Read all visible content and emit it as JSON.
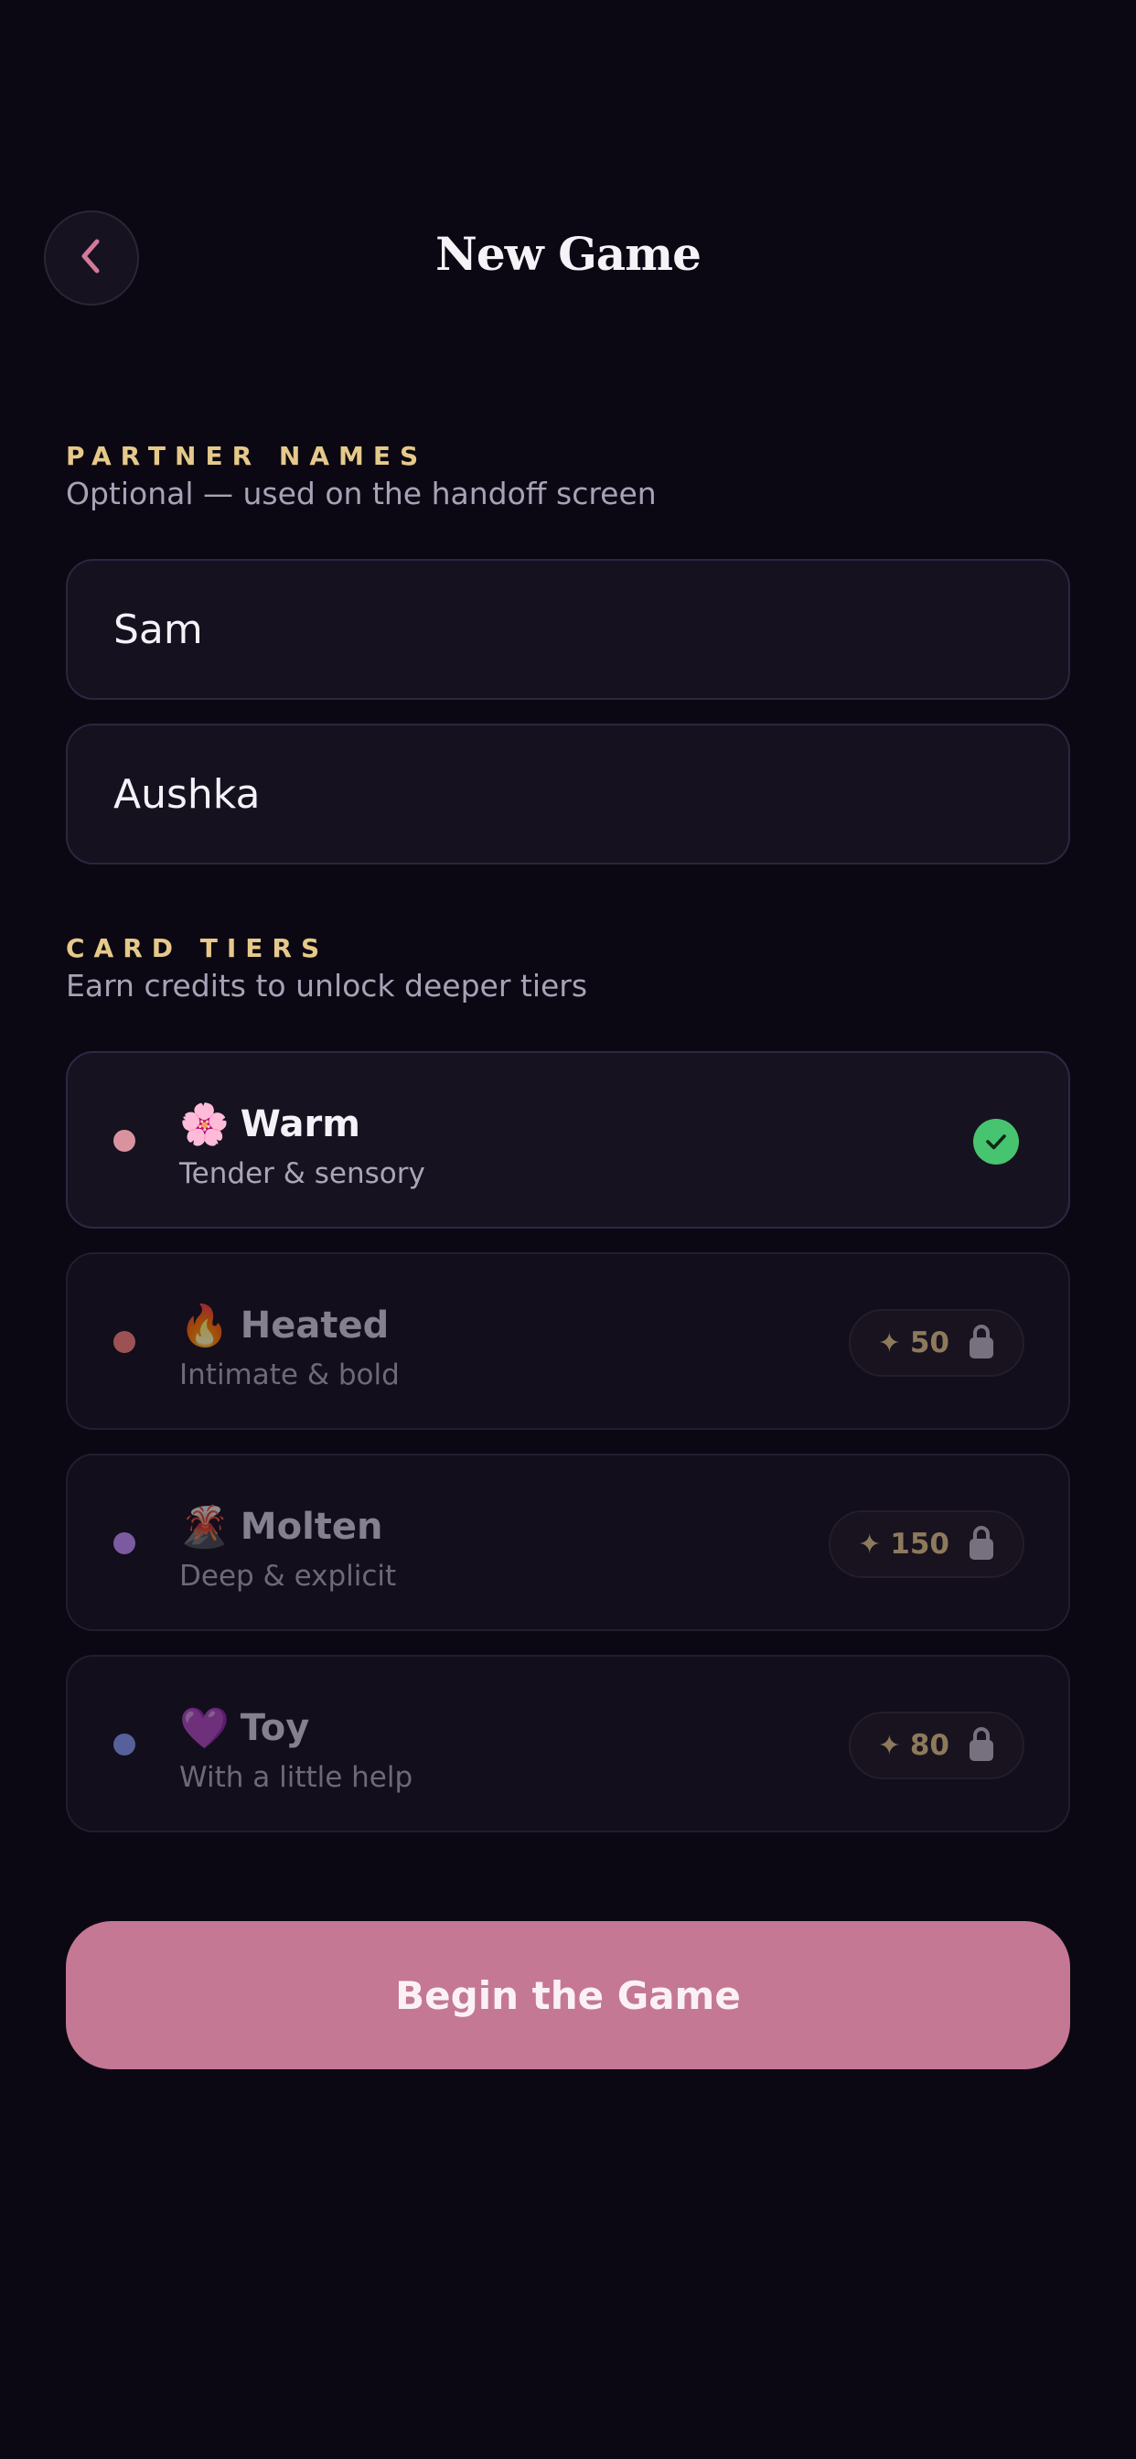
{
  "header": {
    "title": "New Game",
    "back_icon": "chevron-left-icon"
  },
  "partners": {
    "label": "PARTNER NAMES",
    "subtitle": "Optional — used on the handoff screen",
    "names": [
      "Sam",
      "Aushka"
    ]
  },
  "tiers": {
    "label": "CARD TIERS",
    "subtitle": "Earn credits to unlock deeper tiers",
    "items": [
      {
        "emoji": "🌸",
        "name": "Warm",
        "desc": "Tender & sensory",
        "dot_color": "#d9939f",
        "state": "selected"
      },
      {
        "emoji": "🔥",
        "name": "Heated",
        "desc": "Intimate & bold",
        "dot_color": "#9c5252",
        "state": "locked",
        "cost": "50"
      },
      {
        "emoji": "🌋",
        "name": "Molten",
        "desc": "Deep & explicit",
        "dot_color": "#7c5aa0",
        "state": "locked",
        "cost": "150"
      },
      {
        "emoji": "💜",
        "name": "Toy",
        "desc": "With a little help",
        "dot_color": "#57609a",
        "state": "locked",
        "cost": "80"
      }
    ]
  },
  "cta": {
    "label": "Begin the Game"
  },
  "colors": {
    "background": "#0b0813",
    "accent_pink": "#c47894",
    "section_gold": "#e6c98a",
    "check_green": "#47c46f"
  }
}
